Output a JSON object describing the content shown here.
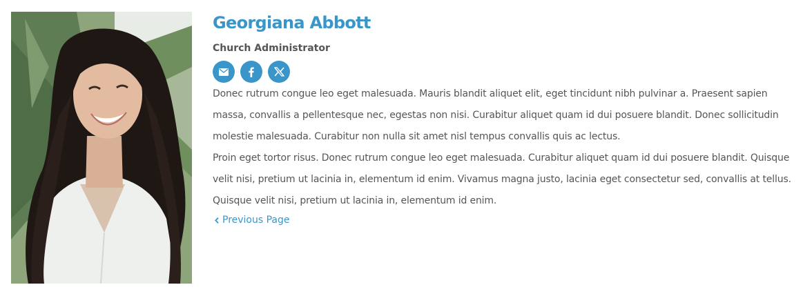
{
  "profile": {
    "name": "Georgiana Abbott",
    "title": "Church Administrator",
    "photo_alt": "Portrait of smiling woman"
  },
  "social": [
    {
      "icon": "envelope-icon",
      "label": "Email"
    },
    {
      "icon": "facebook-icon",
      "label": "Facebook"
    },
    {
      "icon": "x-icon",
      "label": "X"
    }
  ],
  "bio": {
    "paragraph_1": "Donec rutrum congue leo eget malesuada. Mauris blandit aliquet elit, eget tincidunt nibh pulvinar a. Praesent sapien massa, convallis a pellentesque nec, egestas non nisi. Curabitur aliquet quam id dui posuere blandit. Donec sollicitudin molestie malesuada. Curabitur non nulla sit amet nisl tempus convallis quis ac lectus.",
    "paragraph_2": "Proin eget tortor risus. Donec rutrum congue leo eget malesuada. Curabitur aliquet quam id dui posuere blandit. Quisque velit nisi, pretium ut lacinia in, elementum id enim. Vivamus magna justo, lacinia eget consectetur sed, convallis at tellus. Quisque velit nisi, pretium ut lacinia in, elementum id enim."
  },
  "navigation": {
    "previous_label": "Previous Page"
  },
  "colors": {
    "accent": "#3a95c8",
    "text": "#555555",
    "background": "#ffffff"
  }
}
